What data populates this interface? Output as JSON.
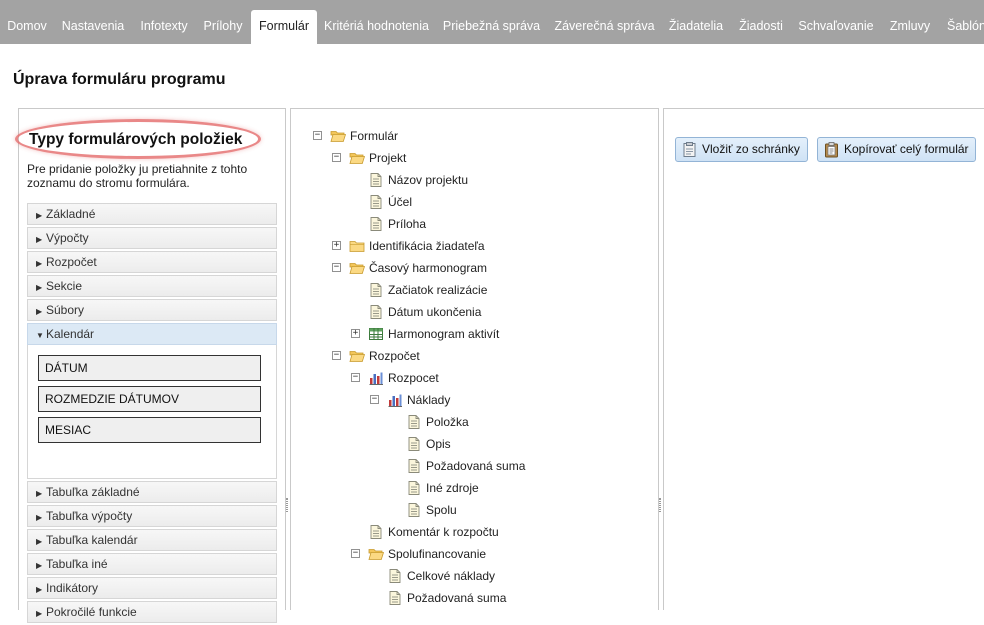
{
  "nav": {
    "tabs": [
      {
        "label": "Domov"
      },
      {
        "label": "Nastavenia"
      },
      {
        "label": "Infotexty"
      },
      {
        "label": "Prílohy"
      },
      {
        "label": "Formulár",
        "active": true
      },
      {
        "label": "Kritériá hodnotenia"
      },
      {
        "label": "Priebežná správa"
      },
      {
        "label": "Záverečná správa"
      },
      {
        "label": "Žiadatelia"
      },
      {
        "label": "Žiadosti"
      },
      {
        "label": "Schvaľovanie"
      },
      {
        "label": "Zmluvy"
      },
      {
        "label": "Šablón"
      }
    ]
  },
  "page_title": "Úprava formuláru programu",
  "types_panel": {
    "title": "Typy formulárových položiek",
    "description": "Pre pridanie položky ju pretiahnite z tohto zoznamu do stromu formulára.",
    "sections": [
      {
        "label": "Základné",
        "open": false
      },
      {
        "label": "Výpočty",
        "open": false
      },
      {
        "label": "Rozpočet",
        "open": false
      },
      {
        "label": "Sekcie",
        "open": false
      },
      {
        "label": "Súbory",
        "open": false
      },
      {
        "label": "Kalendár",
        "open": true,
        "items": [
          "DÁTUM",
          "ROZMEDZIE DÁTUMOV",
          "MESIAC"
        ]
      },
      {
        "label": "Tabuľka základné",
        "open": false
      },
      {
        "label": "Tabuľka výpočty",
        "open": false
      },
      {
        "label": "Tabuľka kalendár",
        "open": false
      },
      {
        "label": "Tabuľka iné",
        "open": false
      },
      {
        "label": "Indikátory",
        "open": false
      },
      {
        "label": "Pokročilé funkcie",
        "open": false
      }
    ]
  },
  "tree": {
    "nodes": [
      {
        "label": "Formulár",
        "icon": "folder-open-icon",
        "toggle": "minus",
        "level": 0
      },
      {
        "label": "Projekt",
        "icon": "folder-open-icon",
        "toggle": "minus",
        "level": 1
      },
      {
        "label": "Názov projektu",
        "icon": "document-icon",
        "toggle": "",
        "level": 2
      },
      {
        "label": "Účel",
        "icon": "document-icon",
        "toggle": "",
        "level": 2
      },
      {
        "label": "Príloha",
        "icon": "document-icon",
        "toggle": "",
        "level": 2
      },
      {
        "label": "Identifikácia žiadateľa",
        "icon": "folder-closed-icon",
        "toggle": "plus",
        "level": 1
      },
      {
        "label": "Časový harmonogram",
        "icon": "folder-open-icon",
        "toggle": "minus",
        "level": 1
      },
      {
        "label": "Začiatok realizácie",
        "icon": "document-icon",
        "toggle": "",
        "level": 2
      },
      {
        "label": "Dátum ukončenia",
        "icon": "document-icon",
        "toggle": "",
        "level": 2
      },
      {
        "label": "Harmonogram aktivít",
        "icon": "table-icon",
        "toggle": "plus",
        "level": 2
      },
      {
        "label": "Rozpočet",
        "icon": "folder-open-icon",
        "toggle": "minus",
        "level": 1
      },
      {
        "label": "Rozpocet",
        "icon": "bar-chart-icon",
        "toggle": "minus",
        "level": 2
      },
      {
        "label": "Náklady",
        "icon": "bar-chart-icon",
        "toggle": "minus",
        "level": 3
      },
      {
        "label": "Položka",
        "icon": "document-icon",
        "toggle": "",
        "level": 4
      },
      {
        "label": "Opis",
        "icon": "document-icon",
        "toggle": "",
        "level": 4
      },
      {
        "label": "Požadovaná suma",
        "icon": "document-icon",
        "toggle": "",
        "level": 4
      },
      {
        "label": "Iné zdroje",
        "icon": "document-icon",
        "toggle": "",
        "level": 4
      },
      {
        "label": "Spolu",
        "icon": "document-icon",
        "toggle": "",
        "level": 4
      },
      {
        "label": "Komentár k rozpočtu",
        "icon": "document-icon",
        "toggle": "",
        "level": 2
      },
      {
        "label": "Spolufinancovanie",
        "icon": "folder-open-icon",
        "toggle": "minus",
        "level": 2
      },
      {
        "label": "Celkové náklady",
        "icon": "document-icon",
        "toggle": "",
        "level": 3
      },
      {
        "label": "Požadovaná suma",
        "icon": "document-icon",
        "toggle": "",
        "level": 3
      }
    ]
  },
  "actions": {
    "paste_label": "Vložiť zo schránky",
    "copy_label": "Kopírovať celý formulár"
  },
  "colors": {
    "nav_bg": "#a3a3a3",
    "button_bg": "#d6e7f8",
    "highlight_ellipse": "#e46b6b",
    "open_section_bg": "#dce9f5"
  }
}
